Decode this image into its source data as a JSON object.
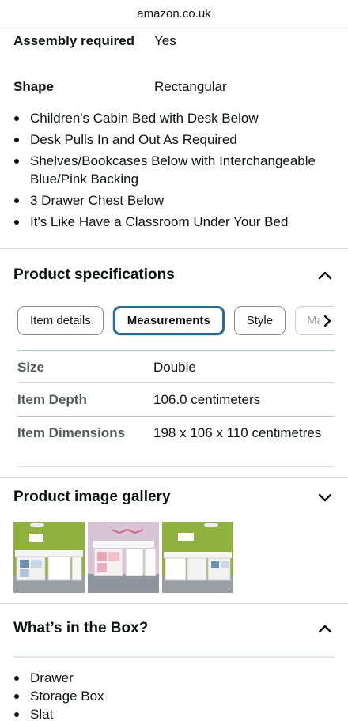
{
  "browser": {
    "url": "amazon.co.uk"
  },
  "details": [
    {
      "label": "Assembly required",
      "value": "Yes"
    },
    {
      "label": "Shape",
      "value": "Rectangular"
    }
  ],
  "bullets": [
    "Children's Cabin Bed with Desk Below",
    "Desk Pulls In and Out As Required",
    "Shelves/Bookcases Below with Interchangeable Blue/Pink Backing",
    "3 Drawer Chest Below",
    "It's Like Have a Classroom Under Your Bed"
  ],
  "specs": {
    "title": "Product specifications",
    "tabs": [
      "Item details",
      "Measurements",
      "Style",
      "Ma"
    ],
    "active_tab": "Measurements",
    "rows": [
      {
        "label": "Size",
        "value": "Double"
      },
      {
        "label": "Item Depth",
        "value": "106.0 centimeters"
      },
      {
        "label": "Item Dimensions",
        "value": "198 x 106 x 110 centimetres"
      }
    ]
  },
  "gallery": {
    "title": "Product image gallery"
  },
  "box": {
    "title": "What’s in the Box?",
    "items": [
      "Drawer",
      "Storage Box",
      "Slat"
    ]
  },
  "colors": {
    "active_tab_border": "#2a6b95",
    "divider": "#d5d9d9",
    "label_grey": "#565959"
  }
}
